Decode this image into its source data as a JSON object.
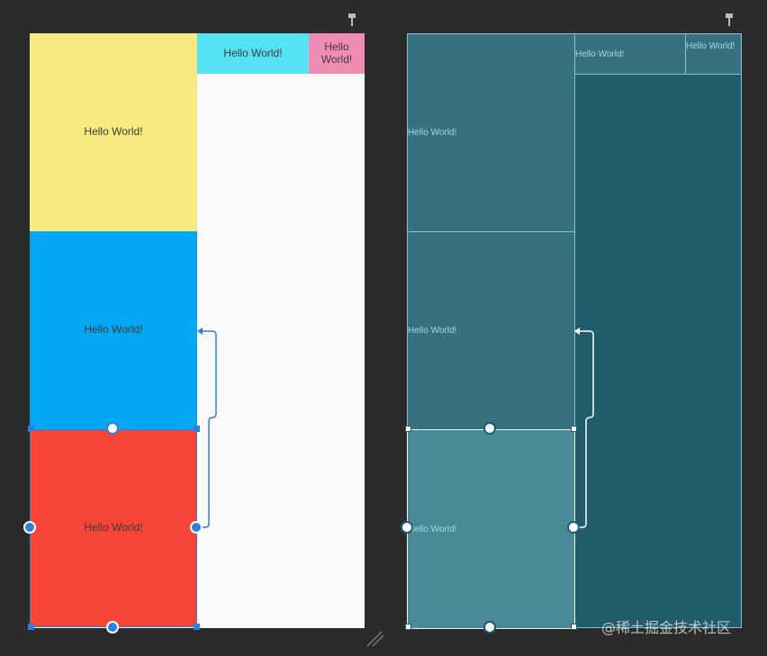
{
  "design": {
    "yellow_box": "Hello World!",
    "blue_box": "Hello World!",
    "red_box": "Hello World!",
    "cyan_box": "Hello World!",
    "pink_box": "Hello\nWorld!"
  },
  "blueprint": {
    "box1": "Hello World!",
    "box2": "Hello World!",
    "box3": "Hello World!",
    "box4": "Hello World!",
    "box5": "Hello World!"
  },
  "watermark": "@稀土掘金技术社区",
  "colors": {
    "yellow": "#f6ea80",
    "blue": "#03a7f4",
    "red": "#f64436",
    "cyan": "#53e3f2",
    "pink": "#ef8cb3",
    "constraint": "#2e7fe0"
  }
}
